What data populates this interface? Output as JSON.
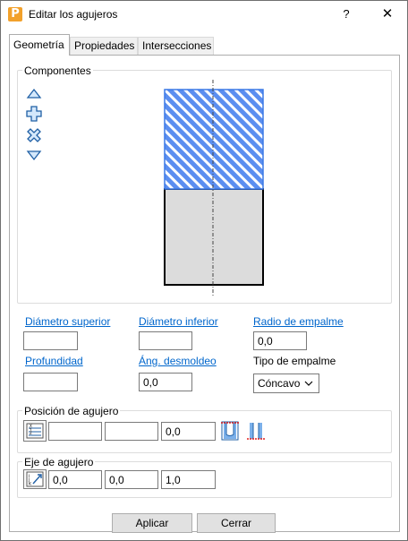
{
  "window": {
    "title": "Editar los agujeros",
    "app_icon_letter": "P",
    "help_label": "?",
    "close_label": "✕"
  },
  "tabs": [
    {
      "label": "Geometría",
      "active": true
    },
    {
      "label": "Propiedades",
      "active": false
    },
    {
      "label": "Intersecciones",
      "active": false
    }
  ],
  "componentes": {
    "label": "Componentes",
    "tools": [
      {
        "name": "move-up-icon"
      },
      {
        "name": "add-icon"
      },
      {
        "name": "delete-icon"
      },
      {
        "name": "move-down-icon"
      }
    ],
    "segment_selected_color": "#5b8ef0",
    "segment_plain_color": "#dcdcdc"
  },
  "fields": {
    "diametro_superior": {
      "label": "Diámetro superior",
      "value": ""
    },
    "diametro_inferior": {
      "label": "Diámetro inferior",
      "value": ""
    },
    "radio_empalme": {
      "label": "Radio de empalme",
      "value": "0,0"
    },
    "profundidad": {
      "label": "Profundidad",
      "value": ""
    },
    "ang_desmoldeo": {
      "label": "Áng. desmoldeo",
      "value": "0,0"
    },
    "tipo_empalme": {
      "label": "Tipo de empalme",
      "value": "Cóncavo"
    }
  },
  "posicion": {
    "label": "Posición de agujero",
    "x": "",
    "y": "",
    "z": "0,0"
  },
  "eje": {
    "label": "Eje de agujero",
    "i": "0,0",
    "j": "0,0",
    "k": "1,0"
  },
  "buttons": {
    "apply": "Aplicar",
    "close": "Cerrar"
  }
}
